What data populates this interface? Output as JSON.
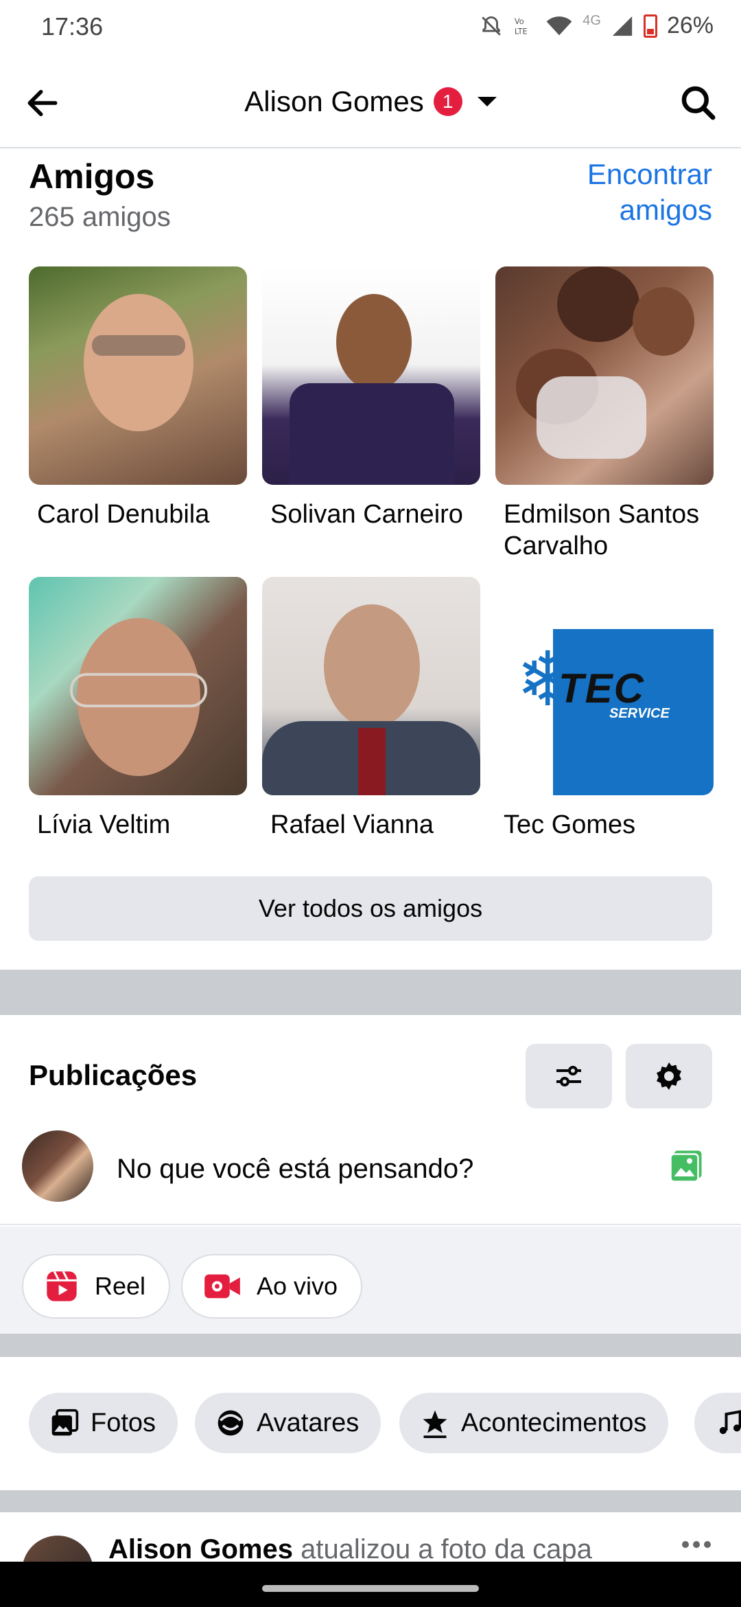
{
  "status_bar": {
    "time": "17:36",
    "network": "4G",
    "battery": "26%"
  },
  "header": {
    "name": "Alison Gomes",
    "notification_count": "1"
  },
  "friends": {
    "title": "Amigos",
    "count": "265 amigos",
    "find_link": "Encontrar amigos",
    "items": [
      {
        "name": "Carol Denubila"
      },
      {
        "name": "Solivan Carneiro"
      },
      {
        "name": "Edmilson Santos Carvalho"
      },
      {
        "name": "Lívia Veltim"
      },
      {
        "name": "Rafael Vianna"
      },
      {
        "name": "Tec Gomes",
        "logo_text": "TEC",
        "logo_subtext": "SERVICE"
      }
    ],
    "see_all": "Ver todos os amigos"
  },
  "posts": {
    "title": "Publicações",
    "composer_placeholder": "No que você está pensando?",
    "actions": [
      {
        "label": "Reel",
        "icon": "reel-icon"
      },
      {
        "label": "Ao vivo",
        "icon": "live-video-icon"
      }
    ]
  },
  "chips": [
    {
      "label": "Fotos",
      "icon": "photos-icon"
    },
    {
      "label": "Avatares",
      "icon": "avatar-icon"
    },
    {
      "label": "Acontecimentos",
      "icon": "life-event-icon"
    }
  ],
  "feed": {
    "author": "Alison Gomes",
    "action": "atualizou a foto da capa"
  },
  "colors": {
    "accent": "#1b74e4",
    "badge": "#e41e3f",
    "divider": "#c9ccd1"
  }
}
